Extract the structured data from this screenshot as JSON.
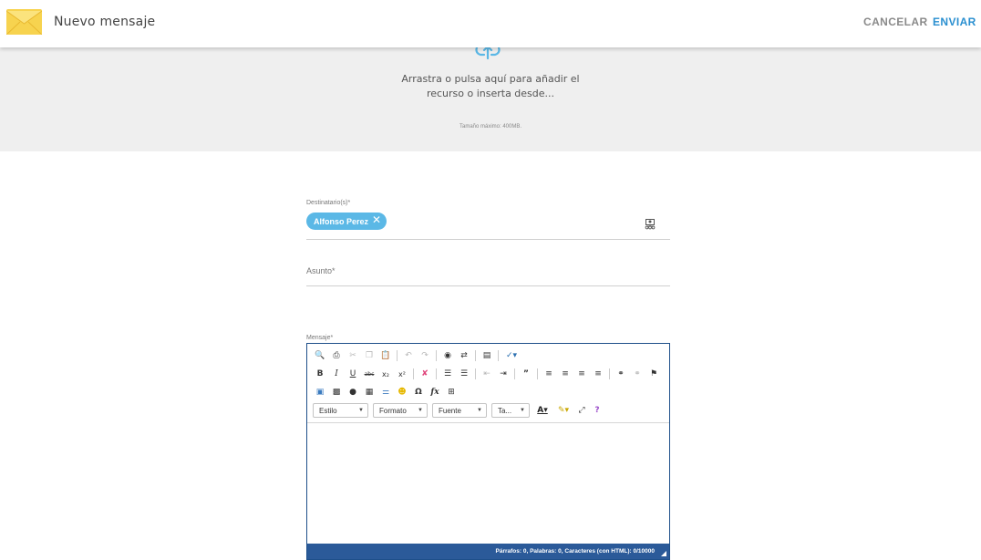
{
  "header": {
    "title": "Nuevo mensaje",
    "cancel_label": "CANCELAR",
    "send_label": "ENVIAR",
    "icon": "envelope-icon"
  },
  "colors": {
    "accent": "#2a8fd0",
    "chip": "#5bb8e6",
    "statusbar": "#2b5a99",
    "envelope": "#f5c842"
  },
  "dropzone": {
    "icon": "cloud-upload-icon",
    "line1": "Arrastra o pulsa aquí para añadir el",
    "line2": "recurso o inserta desde...",
    "max_size": "Tamaño máximo: 400MB."
  },
  "recipients": {
    "label": "Destinatario(s)*",
    "chips": [
      {
        "name": "Alfonso Perez",
        "remove": "✕"
      }
    ],
    "icon": "address-book-icon"
  },
  "subject": {
    "label": "Asunto*"
  },
  "message": {
    "label": "Mensaje*",
    "combos": [
      {
        "label": "Estilo"
      },
      {
        "label": "Formato"
      },
      {
        "label": "Fuente"
      },
      {
        "label": "Ta..."
      }
    ],
    "status": "Párrafos: 0, Palabras: 0, Caracteres (con HTML): 0/10000"
  }
}
